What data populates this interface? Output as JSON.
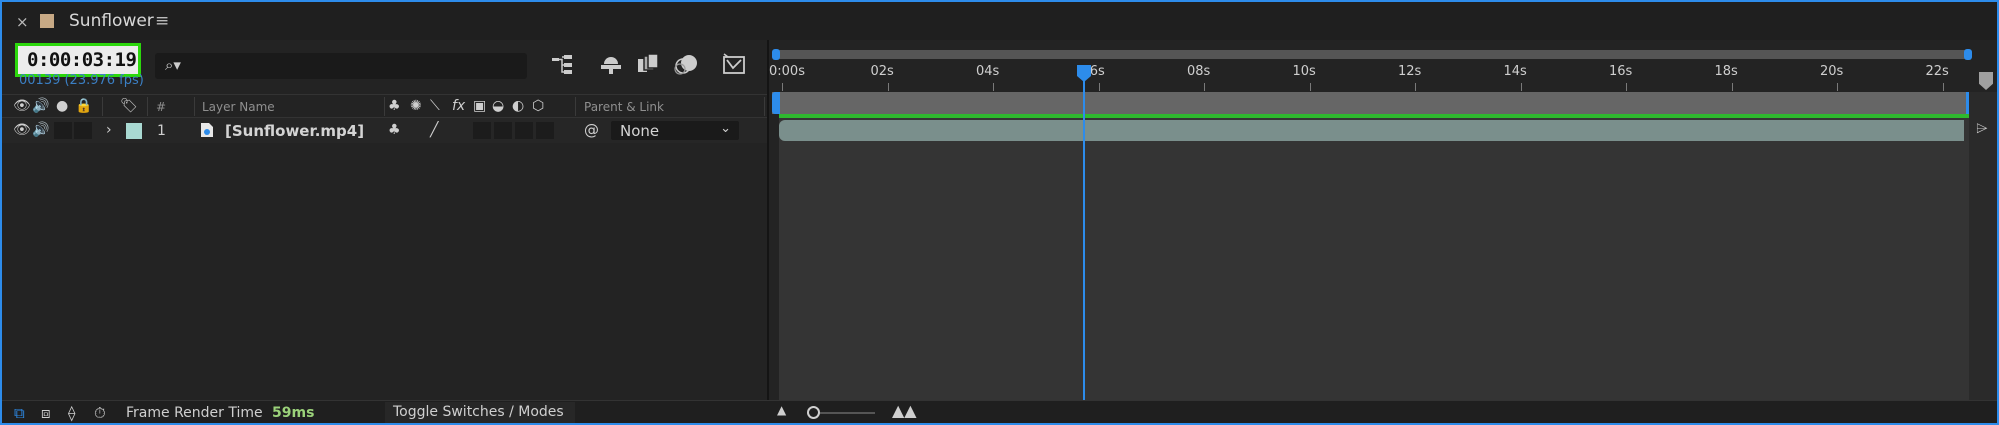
{
  "tab": {
    "close": "×",
    "title": "Sunflower",
    "menu": "≡"
  },
  "time": {
    "timecode": "0:00:03:19",
    "frame_info": "00139 (23.976 fps)"
  },
  "search": {
    "icon": "⌕▾"
  },
  "columns": {
    "index": "#",
    "layer_name": "Layer Name",
    "parent_link": "Parent & Link"
  },
  "layer": {
    "index": "1",
    "name": "[Sunflower.mp4]",
    "parent": "None",
    "parent_arrow": "⌄"
  },
  "ruler": {
    "ticks": [
      "0:00s",
      "02s",
      "04s",
      "06s",
      "08s",
      "10s",
      "12s",
      "14s",
      "16s",
      "18s",
      "20s",
      "22s"
    ]
  },
  "bottom": {
    "render_label": "Frame Render Time",
    "render_value": "59ms",
    "toggle_label": "Toggle Switches / Modes"
  },
  "colors": {
    "accent": "#2d8ceb",
    "timecode_border": "#2cd80c",
    "layer_label": "#a9d9d2",
    "comp_color": "#c7a985",
    "layer_bar": "#7a8f8c",
    "green_line": "#2fb92f",
    "render_value": "#9bd27a"
  },
  "icons": [
    "eye-icon",
    "audio-icon",
    "solo-icon",
    "lock-icon",
    "label-tag-icon",
    "shy-icon",
    "collapse-icon",
    "quality-icon",
    "fx-icon",
    "motion-blur-icon",
    "adjustment-icon",
    "3d-icon",
    "pickwhip-icon",
    "media-file-icon",
    "graph-editor-icon",
    "draft-3d-icon",
    "frame-blending-icon",
    "motion-blur-toggle-icon",
    "chart-icon",
    "comp-marker-icon"
  ]
}
